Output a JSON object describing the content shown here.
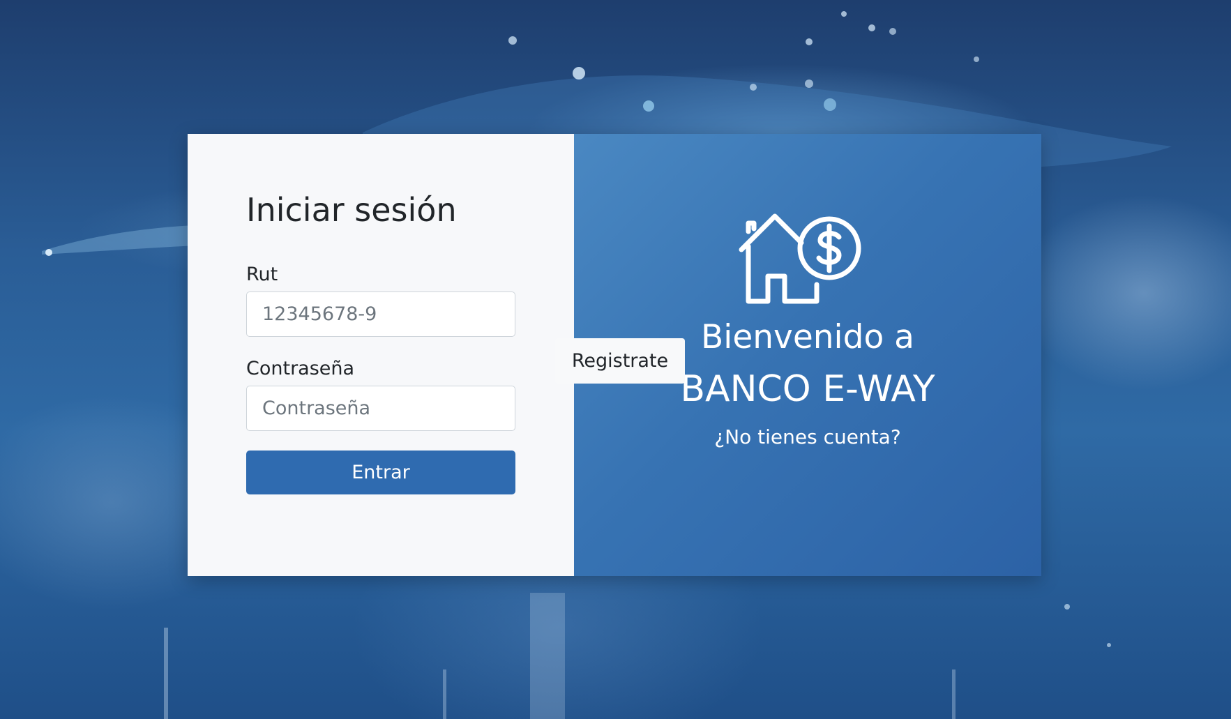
{
  "login": {
    "title": "Iniciar sesión",
    "rut_label": "Rut",
    "rut_placeholder": "12345678-9",
    "password_label": "Contraseña",
    "password_placeholder": "Contraseña",
    "submit_label": "Entrar"
  },
  "welcome": {
    "logo_icon": "house-dollar-icon",
    "line1": "Bienvenido a",
    "bank_name": "BANCO E-WAY",
    "no_account": "¿No tienes cuenta?",
    "register_label": "Registrate"
  },
  "colors": {
    "primary": "#2f6bb0",
    "panel_gradient_start": "#4a88c2",
    "panel_gradient_end": "#2c62a6",
    "left_panel_bg": "#f7f8fa"
  }
}
